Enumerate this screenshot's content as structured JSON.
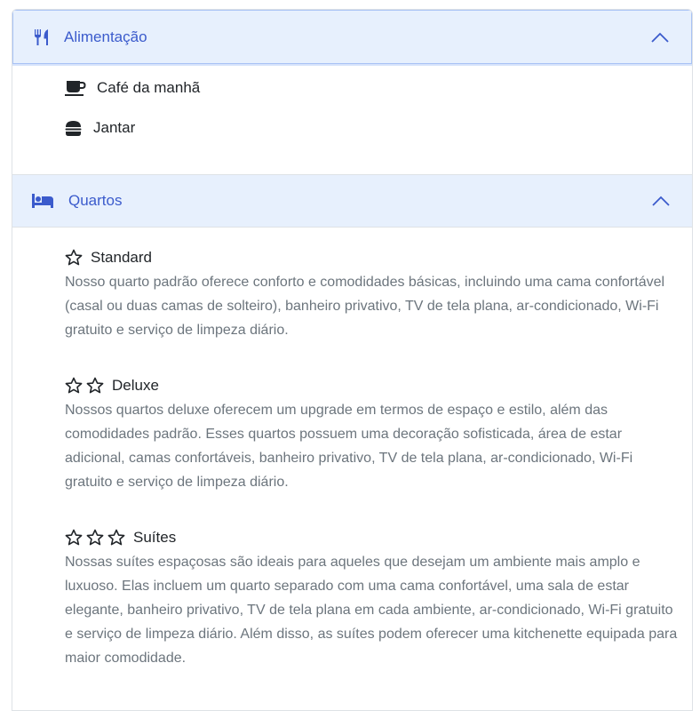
{
  "food": {
    "title": "Alimentação",
    "icon": "utensils-icon",
    "items": [
      {
        "label": "Café da manhã",
        "icon": "coffee-mug-icon"
      },
      {
        "label": "Jantar",
        "icon": "burger-icon"
      }
    ]
  },
  "rooms": {
    "title": "Quartos",
    "icon": "bed-icon",
    "items": [
      {
        "stars": 1,
        "name": "Standard",
        "description": "Nosso quarto padrão oferece conforto e comodidades básicas, incluindo uma cama confortável (casal ou duas camas de solteiro), banheiro privativo, TV de tela plana, ar-condicionado, Wi-Fi gratuito e serviço de limpeza diário."
      },
      {
        "stars": 2,
        "name": "Deluxe",
        "description": "Nossos quartos deluxe oferecem um upgrade em termos de espaço e estilo, além das comodidades padrão. Esses quartos possuem uma decoração sofisticada, área de estar adicional, camas confortáveis, banheiro privativo, TV de tela plana, ar-condicionado, Wi-Fi gratuito e serviço de limpeza diário."
      },
      {
        "stars": 3,
        "name": "Suítes",
        "description": "Nossas suítes espaçosas são ideais para aqueles que desejam um ambiente mais amplo e luxuoso. Elas incluem um quarto separado com uma cama confortável, uma sala de estar elegante, banheiro privativo, TV de tela plana em cada ambiente, ar-condicionado, Wi-Fi gratuito e serviço de limpeza diário. Além disso, as suítes podem oferecer uma kitchenette equipada para maior comodidade."
      }
    ]
  },
  "colors": {
    "header_bg": "#e7f0fd",
    "header_text": "#3b5bcc",
    "description_text": "#6c757d"
  }
}
